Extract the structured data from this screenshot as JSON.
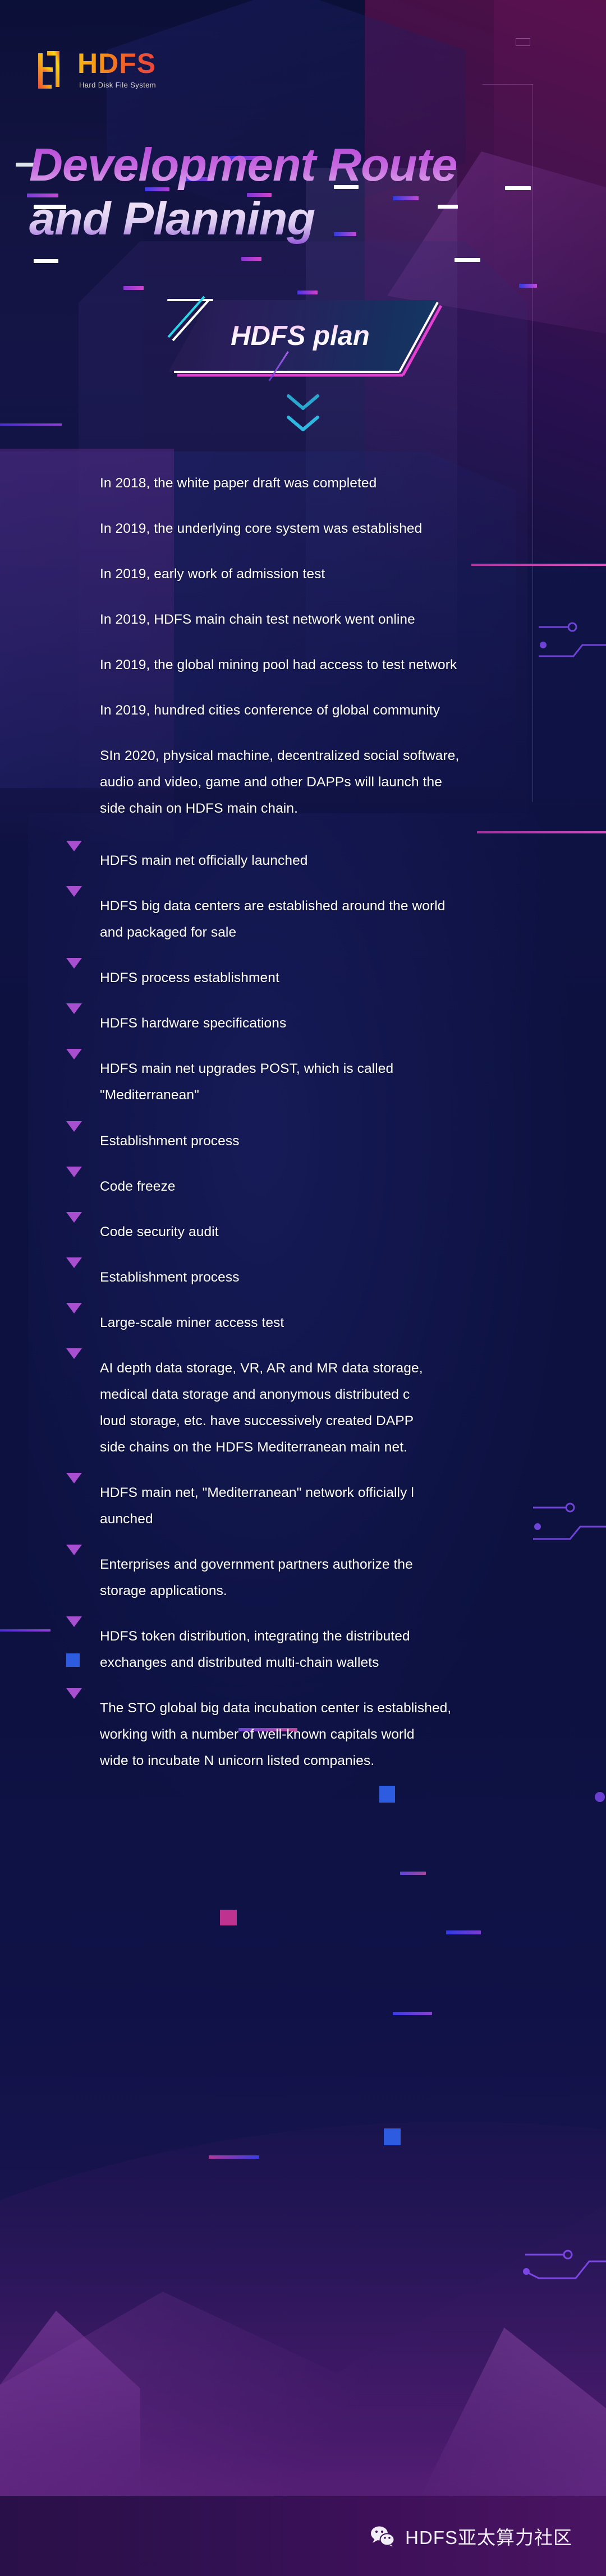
{
  "brand": {
    "logo_word": "HDFS",
    "logo_tagline": "Hard Disk File System",
    "logo_icon": "hdfs-bracket-logo-icon"
  },
  "header": {
    "title_line1": "Development Route",
    "title_line2": "and Planning",
    "banner_label": "HDFS plan",
    "scroll_icon": "double-chevron-down-icon"
  },
  "colors": {
    "page_bg": "#0d1140",
    "accent_purple": "#a84fd0",
    "accent_magenta": "#e046c8",
    "accent_cyan": "#2fc7e0",
    "logo_gradient_start": "#f5b817",
    "logo_gradient_end": "#e8443f",
    "footer_bg": "#3e1059",
    "text": "#ffffff"
  },
  "timeline": {
    "items": [
      {
        "bullet": "square",
        "text": "In 2018, the white paper draft was completed"
      },
      {
        "bullet": "square",
        "text": "In 2019, the underlying core system was established"
      },
      {
        "bullet": "square",
        "text": "In 2019, early work of admission test"
      },
      {
        "bullet": "square",
        "text": "In 2019, HDFS main chain test network went online"
      },
      {
        "bullet": "square",
        "text": "In 2019, the global mining pool had access to test network"
      },
      {
        "bullet": "square",
        "text": "In 2019, hundred cities conference of global community"
      },
      {
        "bullet": "square",
        "text": "SIn 2020, physical machine, decentralized social software,\naudio and video, game and other DAPPs will launch the\nside chain on HDFS main chain."
      },
      {
        "bullet": "triangle",
        "text": "HDFS main net officially launched"
      },
      {
        "bullet": "triangle",
        "text": "HDFS big data centers are established around the world\nand packaged for sale"
      },
      {
        "bullet": "triangle",
        "text": "HDFS process establishment"
      },
      {
        "bullet": "triangle",
        "text": "HDFS hardware specifications"
      },
      {
        "bullet": "triangle",
        "text": "HDFS main net upgrades POST, which is called\n\"Mediterranean\""
      },
      {
        "bullet": "triangle",
        "text": "Establishment process"
      },
      {
        "bullet": "triangle",
        "text": "Code freeze"
      },
      {
        "bullet": "triangle",
        "text": "Code security audit"
      },
      {
        "bullet": "triangle",
        "text": "Establishment process"
      },
      {
        "bullet": "triangle",
        "text": "Large-scale miner access test"
      },
      {
        "bullet": "triangle",
        "text": "AI depth data storage, VR, AR and MR data storage,\nmedical data storage and anonymous distributed c\nloud storage, etc. have successively created DAPP\nside chains on the HDFS Mediterranean main net."
      },
      {
        "bullet": "triangle",
        "text": "HDFS main net, \"Mediterranean\" network officially l\naunched"
      },
      {
        "bullet": "triangle",
        "text": "Enterprises and government partners authorize the\nstorage applications."
      },
      {
        "bullet": "triangle",
        "text": "HDFS token distribution, integrating the distributed\nexchanges and distributed multi-chain wallets"
      },
      {
        "bullet": "triangle",
        "text": "The STO global big data incubation center is established,\nworking with a number of well-known capitals world\nwide to incubate N unicorn listed companies."
      }
    ]
  },
  "footer": {
    "account_name": "HDFS亚太算力社区",
    "icon": "wechat-icon"
  }
}
